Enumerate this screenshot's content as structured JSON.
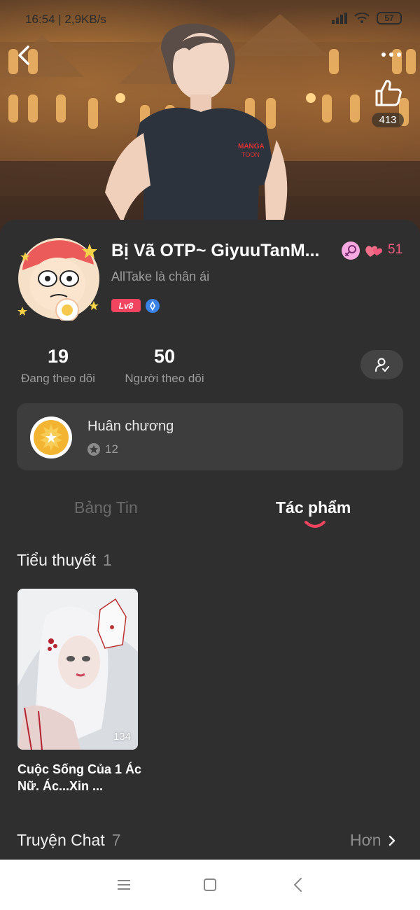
{
  "status_bar": {
    "time_speed": "16:54 | 2,9KB/s",
    "battery": "57"
  },
  "header": {
    "back_icon": "chevron-left-icon",
    "more_icon": "more-dots-icon",
    "like_icon": "thumbs-up-icon",
    "like_count": "413"
  },
  "profile": {
    "name": "Bị Vã OTP~ GiyuuTanM...",
    "bio": "AllTake là chân ái",
    "level": "Lv8",
    "heart_count": "51",
    "following_count": "19",
    "following_label": "Đang theo dõi",
    "followers_count": "50",
    "followers_label": "Người theo dõi"
  },
  "medals": {
    "title": "Huân chương",
    "count": "12"
  },
  "tabs": [
    {
      "label": "Bảng Tin",
      "active": false
    },
    {
      "label": "Tác phẩm",
      "active": true
    }
  ],
  "novels": {
    "title": "Tiểu thuyết",
    "count": "1",
    "items": [
      {
        "title": "Cuộc Sống Của 1 Ác Nữ. Ác...Xin ...",
        "views": "134"
      }
    ]
  },
  "chat_stories": {
    "title": "Truyện Chat",
    "count": "7",
    "more_label": "Hơn"
  },
  "colors": {
    "accent": "#f0445f",
    "background": "#2f2f2f",
    "card": "#3d3d3d",
    "muted_text": "#9c9c9c"
  }
}
